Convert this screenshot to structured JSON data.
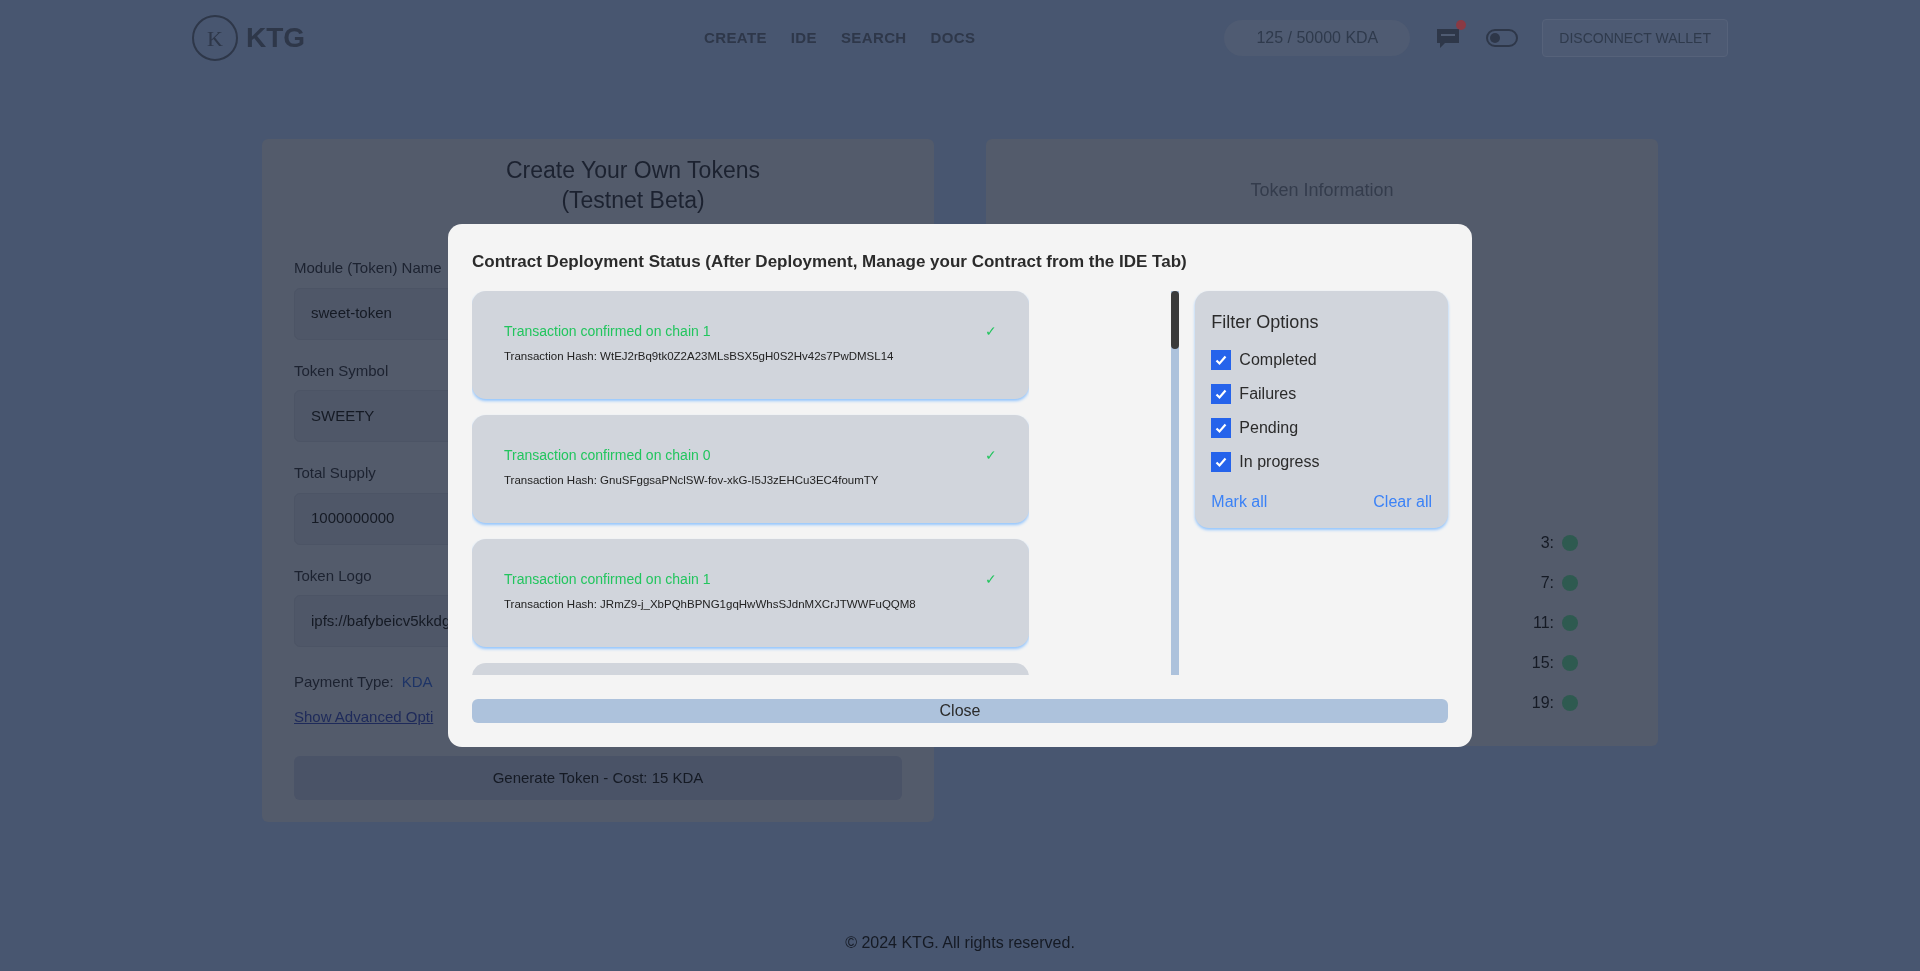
{
  "header": {
    "logo_letter": "K",
    "brand": "KTG",
    "nav": [
      {
        "label": "CREATE"
      },
      {
        "label": "IDE"
      },
      {
        "label": "SEARCH"
      },
      {
        "label": "DOCS"
      }
    ],
    "balance": "125 / 50000 KDA",
    "notification_badge": true,
    "theme_dark": false,
    "wallet_button": "DISCONNECT WALLET"
  },
  "create_card": {
    "title_lines": [
      "Create Your Own Tokens",
      "(Testnet Beta)"
    ],
    "fields": [
      {
        "label": "Module (Token) Name",
        "value": "sweet-token"
      },
      {
        "label": "Token Symbol",
        "value": "SWEETY"
      },
      {
        "label": "Total Supply",
        "value": "1000000000"
      },
      {
        "label": "Token Logo",
        "value": "ipfs://bafybeicv5kkdg"
      }
    ],
    "payment_label": "Payment Type:",
    "payment_value": "KDA",
    "advanced_link": "Show Advanced Opti",
    "generate_button": "Generate Token - Cost: 15 KDA"
  },
  "info_card": {
    "title": "Token Information",
    "chains": [
      {
        "label": "3:",
        "color": "#2e5a50"
      },
      {
        "label": "7:",
        "color": "#2e5a50"
      },
      {
        "label": "11:",
        "color": "#2e5a50"
      },
      {
        "label": "15:",
        "color": "#2e5a50"
      },
      {
        "label": "19:",
        "color": "#2e5a50"
      }
    ]
  },
  "modal": {
    "title": "Contract Deployment Status (After Deployment, Manage your Contract from the IDE Tab)",
    "transactions": [
      {
        "kind": "confirmed",
        "status": "Transaction confirmed on chain 1",
        "mark": "✓",
        "hash": "Transaction Hash: WtEJ2rBq9tk0Z2A23MLsBSX5gH0S2Hv42s7PwDMSL14"
      },
      {
        "kind": "confirmed",
        "status": "Transaction confirmed on chain 0",
        "mark": "✓",
        "hash": "Transaction Hash: GnuSFggsaPNclSW-fov-xkG-I5J3zEHCu3EC4foumTY"
      },
      {
        "kind": "confirmed",
        "status": "Transaction confirmed on chain 1",
        "mark": "✓",
        "hash": "Transaction Hash: JRmZ9-j_XbPQhBPNG1gqHwWhsSJdnMXCrJTWWFuQQM8"
      }
    ],
    "more_below": true,
    "filter": {
      "title": "Filter Options",
      "options": [
        {
          "label": "Completed",
          "checked": true
        },
        {
          "label": "Failures",
          "checked": true
        },
        {
          "label": "Pending",
          "checked": true
        },
        {
          "label": "In progress",
          "checked": true
        }
      ],
      "mark_all": "Mark all",
      "clear_all": "Clear all"
    },
    "close_button": "Close"
  },
  "footer": "© 2024 KTG. All rights reserved."
}
